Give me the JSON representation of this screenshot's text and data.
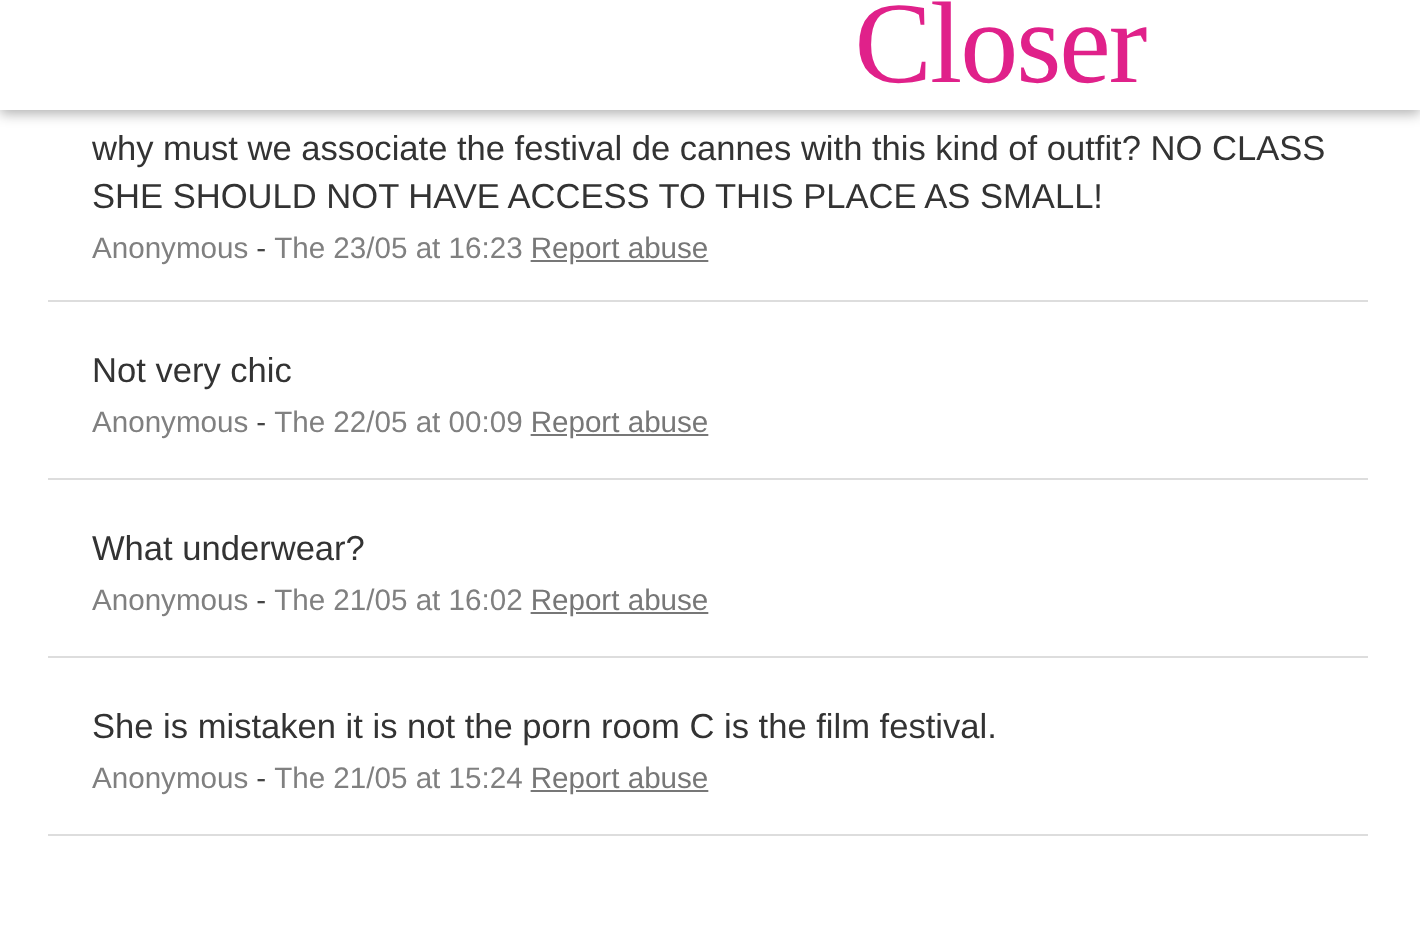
{
  "header": {
    "logo": "Closer"
  },
  "comments": [
    {
      "text": "why must we associate the festival de cannes with this kind of outfit? NO CLASS SHE SHOULD NOT HAVE ACCESS TO THIS PLACE AS SMALL!",
      "author": "Anonymous",
      "separator": "-",
      "date": "The 23/05 at 16:23",
      "report": "Report abuse"
    },
    {
      "text": "Not very chic",
      "author": "Anonymous",
      "separator": "-",
      "date": "The 22/05 at 00:09",
      "report": "Report abuse"
    },
    {
      "text": "What underwear?",
      "author": "Anonymous",
      "separator": "-",
      "date": "The 21/05 at 16:02",
      "report": "Report abuse"
    },
    {
      "text": "She is mistaken it is not the porn room C is the film festival.",
      "author": "Anonymous",
      "separator": "-",
      "date": "The 21/05 at 15:24",
      "report": "Report abuse"
    }
  ]
}
